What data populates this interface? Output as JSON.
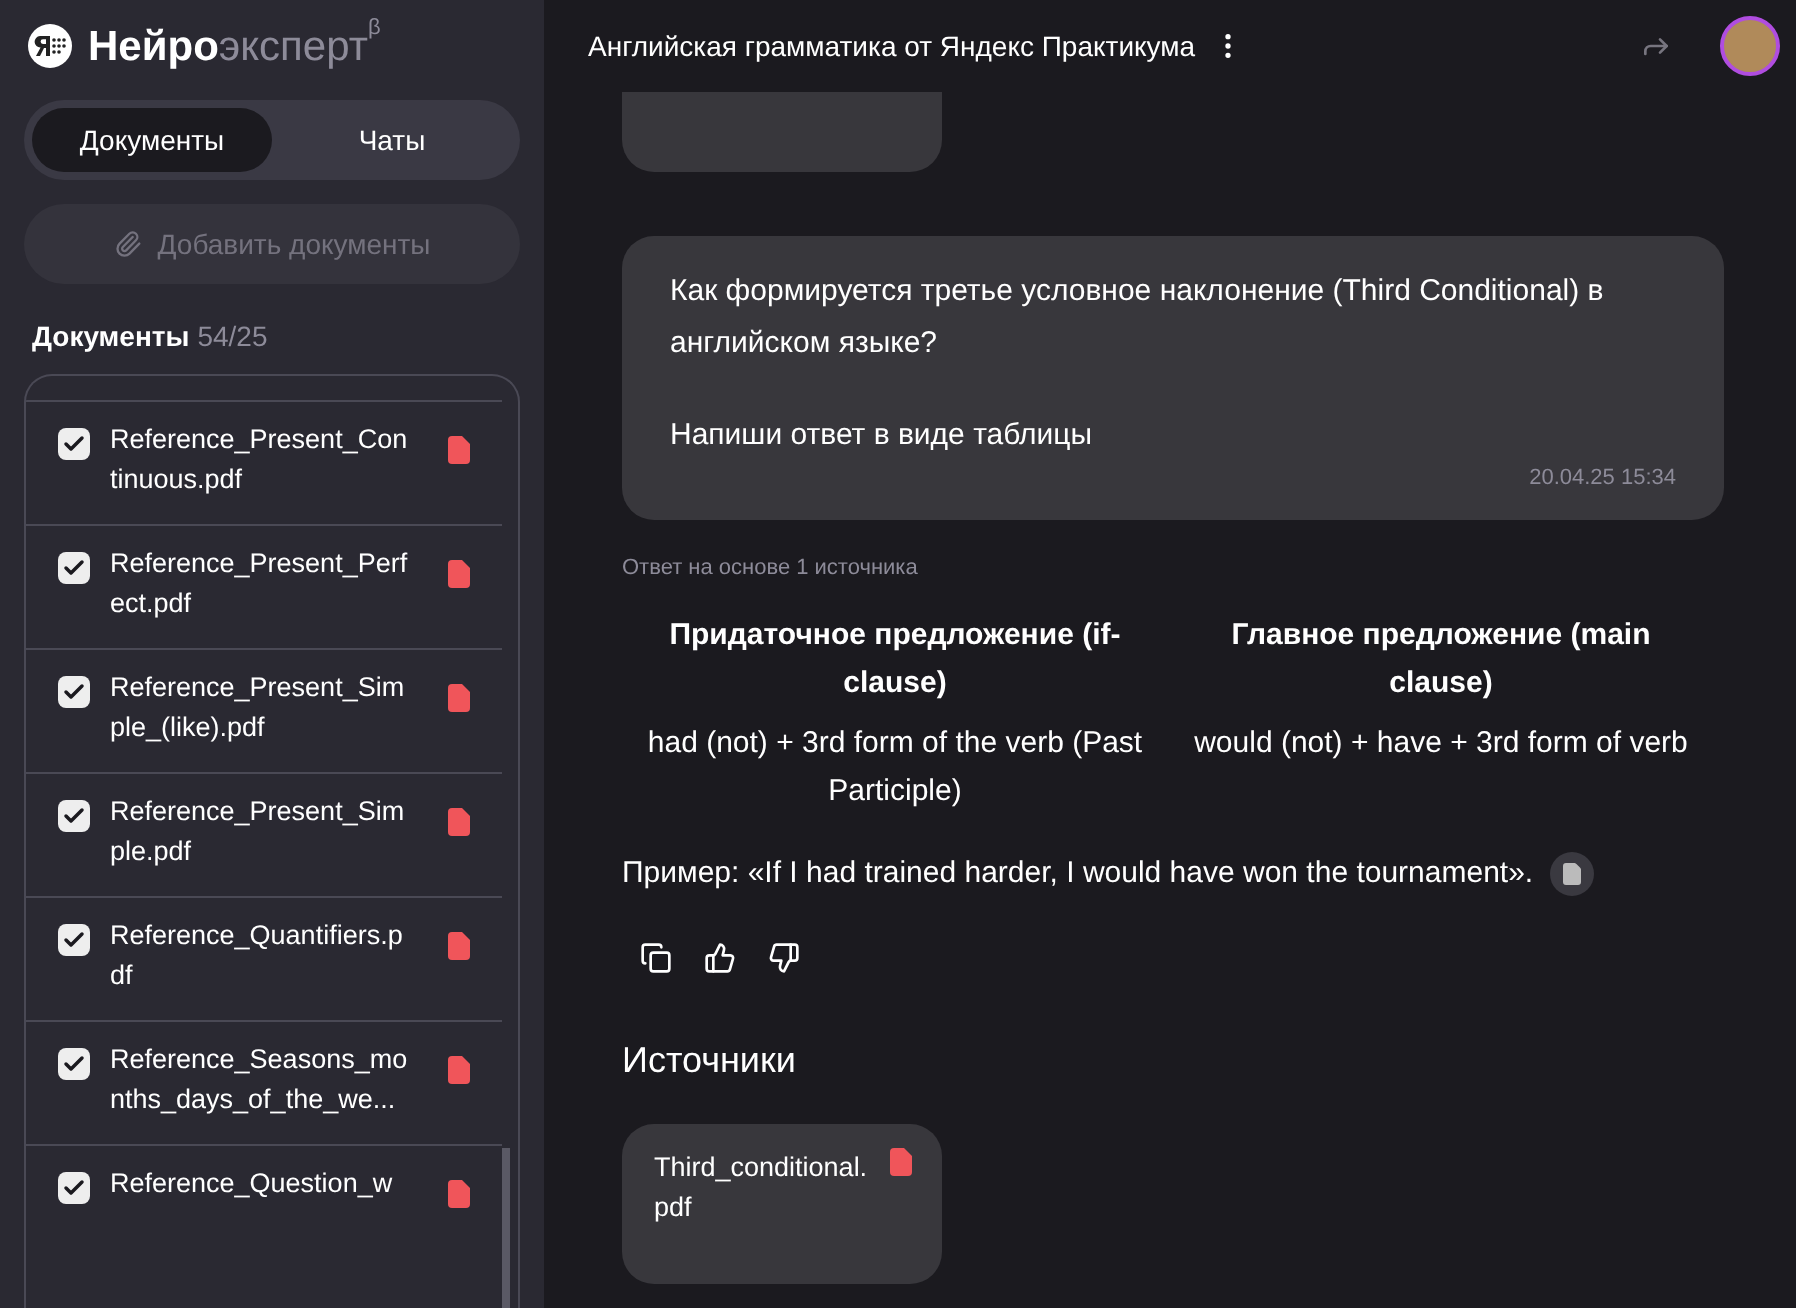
{
  "logo": {
    "strong": "Нейро",
    "light": "эксперт",
    "mark": "β"
  },
  "tabs": [
    {
      "label": "Документы",
      "selected": true
    },
    {
      "label": "Чаты",
      "selected": false
    }
  ],
  "add_button": {
    "label": "Добавить документы",
    "disabled": true
  },
  "documents": {
    "title": "Документы",
    "count": "54/25",
    "items": [
      {
        "name": "Reference_Present_Continuous.pdf",
        "checked": true
      },
      {
        "name": "Reference_Present_Perfect.pdf",
        "checked": true
      },
      {
        "name": "Reference_Present_Simple_(like).pdf",
        "checked": true
      },
      {
        "name": "Reference_Present_Simple.pdf",
        "checked": true
      },
      {
        "name": "Reference_Quantifiers.pdf",
        "checked": true
      },
      {
        "name": "Reference_Seasons_months_days_of_the_we...",
        "checked": true
      },
      {
        "name": "Reference_Question_w",
        "checked": true
      }
    ]
  },
  "chat": {
    "title": "Английская грамматика от Яндекс Практикума",
    "question": {
      "paragraphs": [
        "Как формируется третье условное наклонение (Third Conditional) в английском языке?",
        "Напиши ответ в виде таблицы"
      ],
      "time": "20.04.25 15:34"
    },
    "answer": {
      "source_note": "Ответ на основе 1 источника",
      "table": {
        "columns": [
          "Придаточное предложение (if-clause)",
          "Главное предложение (main clause)"
        ],
        "rows": [
          [
            "had (not) + 3rd form of the verb (Past Participle)",
            "would (not) + have + 3rd form of verb"
          ]
        ]
      },
      "example": "Пример: «If I had trained harder, I would have won the tournament»."
    },
    "sources": {
      "title": "Источники",
      "items": [
        {
          "name": "Third_conditional.pdf"
        }
      ]
    }
  }
}
